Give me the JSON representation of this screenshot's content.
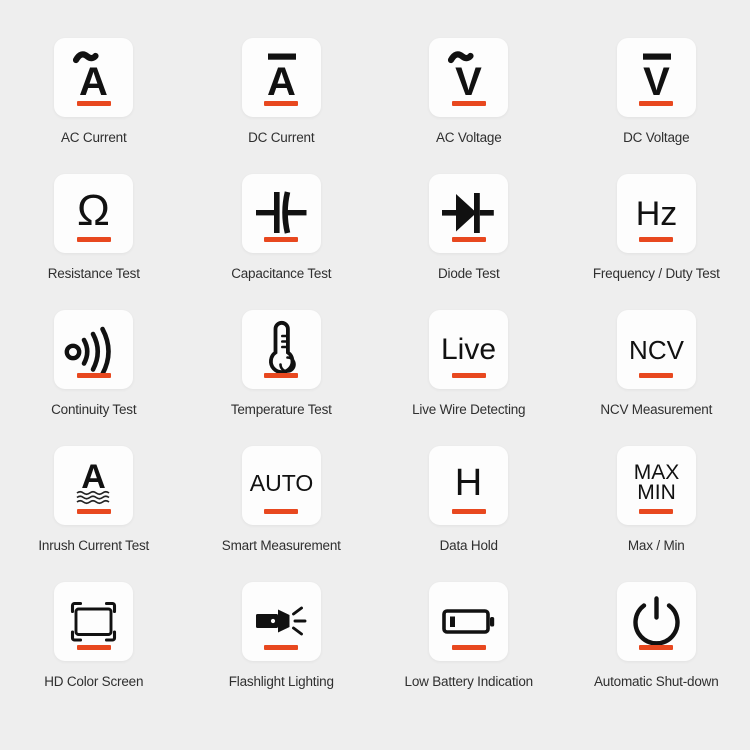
{
  "page": {
    "background_color": "#eeeeee",
    "tile_color": "#fdfdfd",
    "accent_color": "#e8481f",
    "label_color": "#2f2f2f",
    "columns": 4,
    "rows": 5
  },
  "features": [
    {
      "icon": "ac-current-icon",
      "symbol": "Ã",
      "label": "AC Current"
    },
    {
      "icon": "dc-current-icon",
      "symbol": "Ā",
      "label": "DC Current"
    },
    {
      "icon": "ac-voltage-icon",
      "symbol": "Ṽ",
      "label": "AC Voltage"
    },
    {
      "icon": "dc-voltage-icon",
      "symbol": "V̄",
      "label": "DC Voltage"
    },
    {
      "icon": "resistance-ohm-icon",
      "symbol": "Ω",
      "label": "Resistance Test"
    },
    {
      "icon": "capacitor-icon",
      "symbol": "",
      "label": "Capacitance Test"
    },
    {
      "icon": "diode-icon",
      "symbol": "",
      "label": "Diode Test"
    },
    {
      "icon": "frequency-hz-icon",
      "symbol": "Hz",
      "label": "Frequency / Duty Test"
    },
    {
      "icon": "continuity-sound-wave-icon",
      "symbol": "",
      "label": "Continuity Test"
    },
    {
      "icon": "thermometer-icon",
      "symbol": "",
      "label": "Temperature Test"
    },
    {
      "icon": "live-wire-icon",
      "symbol": "Live",
      "label": "Live Wire Detecting"
    },
    {
      "icon": "ncv-icon",
      "symbol": "NCV",
      "label": "NCV  Measurement"
    },
    {
      "icon": "inrush-current-icon",
      "symbol": "A",
      "label": "Inrush Current Test"
    },
    {
      "icon": "auto-range-icon",
      "symbol": "AUTO",
      "label": "Smart Measurement"
    },
    {
      "icon": "data-hold-icon",
      "symbol": "H",
      "label": "Data Hold"
    },
    {
      "icon": "max-min-icon",
      "symbol": "MAX MIN",
      "label": "Max / Min"
    },
    {
      "icon": "hd-screen-frame-icon",
      "symbol": "",
      "label": "HD Color Screen"
    },
    {
      "icon": "flashlight-icon",
      "symbol": "",
      "label": "Flashlight Lighting"
    },
    {
      "icon": "low-battery-icon",
      "symbol": "",
      "label": "Low Battery Indication"
    },
    {
      "icon": "power-shutdown-icon",
      "symbol": "",
      "label": "Automatic Shut-down"
    }
  ]
}
